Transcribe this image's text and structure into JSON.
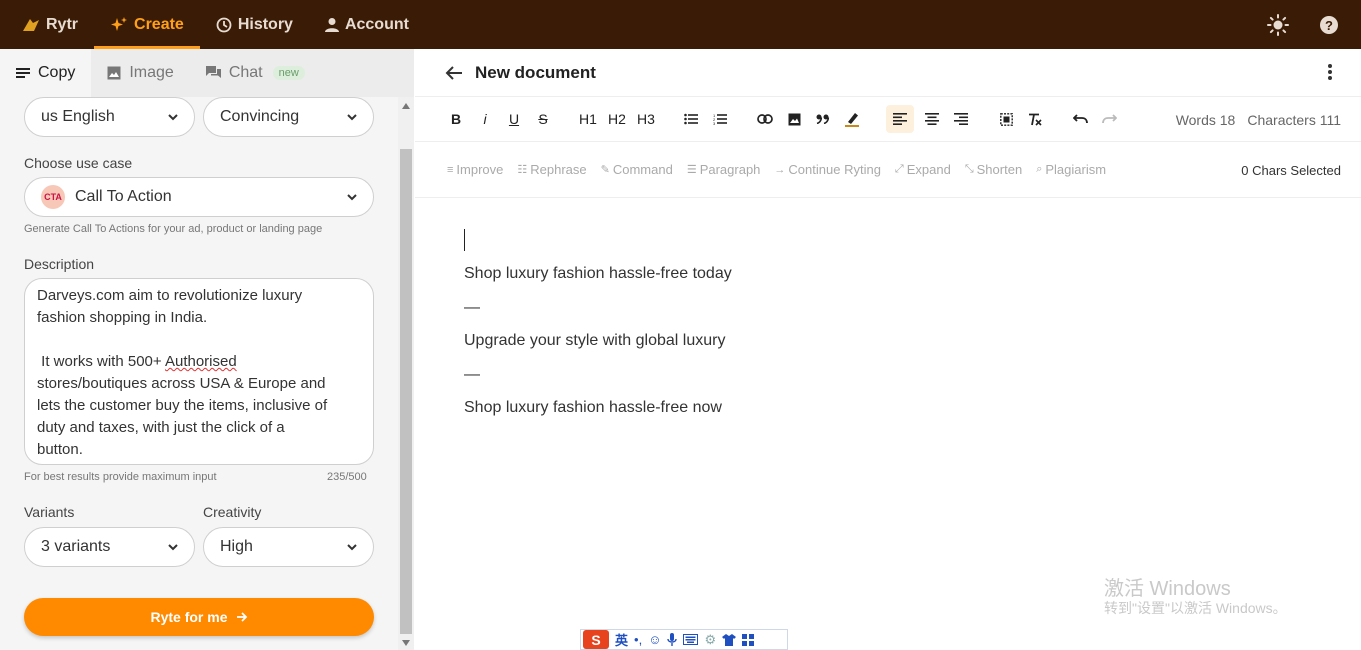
{
  "topbar": {
    "brand": "Rytr",
    "nav": [
      {
        "label": "Create",
        "icon": "sparkle-icon",
        "active": true
      },
      {
        "label": "History",
        "icon": "history-icon",
        "active": false
      },
      {
        "label": "Account",
        "icon": "user-icon",
        "active": false
      }
    ],
    "accent": "#ff9f1a",
    "background": "#3a1c06"
  },
  "left_tabs": [
    {
      "label": "Copy",
      "active": true
    },
    {
      "label": "Image",
      "active": false
    },
    {
      "label": "Chat",
      "active": false,
      "badge": "new"
    }
  ],
  "form": {
    "language": "us English",
    "tone": "Convincing",
    "use_case_label": "Choose use case",
    "use_case": "Call To Action",
    "use_case_hint": "Generate Call To Actions for your ad, product or landing page",
    "description_label": "Description",
    "description_line1": "Darveys.com aim to revolutionize luxury\nfashion shopping in India.\n\n It works with 500+ ",
    "description_misspelled": "Authorised",
    "description_line2": "\nstores/boutiques across USA & Europe and\nlets the customer buy the items, inclusive of\nduty and taxes, with just the click of a\nbutton.",
    "description_hint": "For best results provide maximum input",
    "char_count": "235/500",
    "variants_label": "Variants",
    "variants": "3 variants",
    "creativity_label": "Creativity",
    "creativity": "High",
    "submit_label": "Ryte for me"
  },
  "editor": {
    "title": "New document",
    "toolbar": {
      "bold": "B",
      "italic": "i",
      "underline": "U",
      "strike": "S",
      "h1": "H1",
      "h2": "H2",
      "h3": "H3"
    },
    "words_label": "Words 18",
    "characters_label": "Characters 111",
    "ai_actions": [
      {
        "label": "Improve"
      },
      {
        "label": "Rephrase"
      },
      {
        "label": "Command"
      },
      {
        "label": "Paragraph"
      },
      {
        "label": "Continue Ryting"
      },
      {
        "label": "Expand"
      },
      {
        "label": "Shorten"
      },
      {
        "label": "Plagiarism"
      }
    ],
    "chars_selected": "0 Chars Selected",
    "content": [
      "Shop luxury fashion hassle-free today",
      "—",
      "Upgrade your style with global luxury",
      "—",
      "Shop luxury fashion hassle-free now"
    ]
  },
  "watermark": {
    "line1": "激活 Windows",
    "line2": "转到\"设置\"以激活 Windows。"
  },
  "ime": {
    "lang": "英"
  }
}
